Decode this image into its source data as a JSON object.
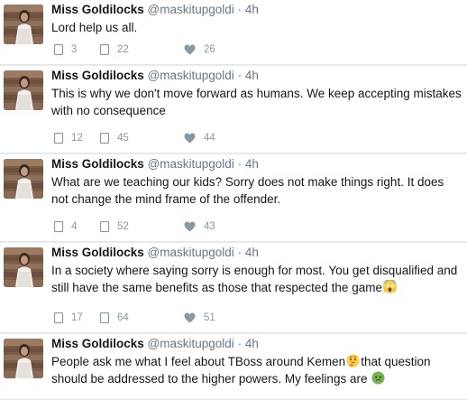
{
  "tweets": [
    {
      "name": "Miss Goldilocks",
      "handle": "@maskitupgoldi",
      "separator": "·",
      "time": "4h",
      "text": "Lord help us all.",
      "replies": "3",
      "retweets": "22",
      "likes": "26"
    },
    {
      "name": "Miss Goldilocks",
      "handle": "@maskitupgoldi",
      "separator": "·",
      "time": "4h",
      "text": "This is why we don't move forward as humans. We keep accepting mistakes with no consequence",
      "replies": "12",
      "retweets": "45",
      "likes": "44"
    },
    {
      "name": "Miss Goldilocks",
      "handle": "@maskitupgoldi",
      "separator": "·",
      "time": "4h",
      "text": "What are we teaching our kids? Sorry does not make things right. It does not change the mind frame of the offender.",
      "replies": "4",
      "retweets": "52",
      "likes": "43"
    },
    {
      "name": "Miss Goldilocks",
      "handle": "@maskitupgoldi",
      "separator": "·",
      "time": "4h",
      "text": "In a society where saying sorry is enough for most. You get disqualified and still have the same benefits as those that respected the game",
      "emoji_end": "screaming-face-emoji",
      "replies": "17",
      "retweets": "64",
      "likes": "51"
    },
    {
      "name": "Miss Goldilocks",
      "handle": "@maskitupgoldi",
      "separator": "·",
      "time": "4h",
      "text_part1": "People ask me what I feel about TBoss around Kemen",
      "emoji_mid": "thinking-face-emoji",
      "text_part2": "that question should be addressed to the higher powers. My feelings are ",
      "emoji_end": "nauseated-face-emoji"
    }
  ],
  "icons": {
    "reply": "reply-icon",
    "retweet": "retweet-icon",
    "like": "heart-icon"
  },
  "colors": {
    "action_gray": "#8899a6",
    "handle_gray": "#657786",
    "text": "#14171a",
    "divider": "#e1e8ed",
    "background": "#e9ecef"
  }
}
